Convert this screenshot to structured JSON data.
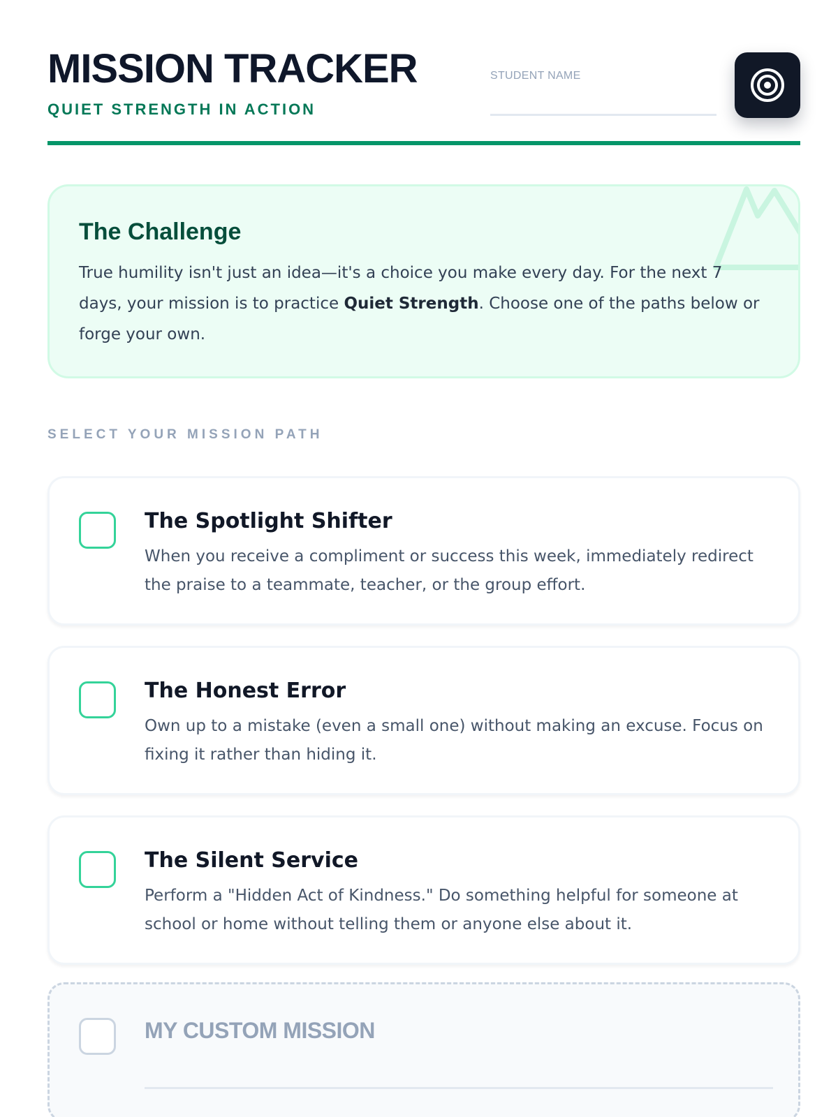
{
  "header": {
    "title": "MISSION TRACKER",
    "subtitle": "QUIET STRENGTH IN ACTION",
    "student_name_label": "STUDENT NAME",
    "student_name_value": "",
    "icon": "target-icon"
  },
  "challenge": {
    "title": "The Challenge",
    "text_before": "True humility isn't just an idea—it's a choice you make every day. For the next 7 days, your mission is to practice ",
    "text_bold": "Quiet Strength",
    "text_after": ". Choose one of the paths below or forge your own.",
    "decoration_icon": "mountain-icon"
  },
  "section_label": "SELECT YOUR MISSION PATH",
  "missions": [
    {
      "title": "The Spotlight Shifter",
      "description": "When you receive a compliment or success this week, immediately redirect the praise to a teammate, teacher, or the group effort.",
      "checked": false
    },
    {
      "title": "The Honest Error",
      "description": "Own up to a mistake (even a small one) without making an excuse. Focus on fixing it rather than hiding it.",
      "checked": false
    },
    {
      "title": "The Silent Service",
      "description": "Perform a \"Hidden Act of Kindness.\" Do something helpful for someone at school or home without telling them or anyone else about it.",
      "checked": false
    }
  ],
  "custom_mission": {
    "title": "MY CUSTOM MISSION",
    "value": "",
    "checked": false
  },
  "colors": {
    "accent": "#059669",
    "accent_dark": "#064e3b",
    "challenge_bg": "#ecfdf5",
    "checkbox_border": "#34d399",
    "dark_button": "#111827"
  }
}
